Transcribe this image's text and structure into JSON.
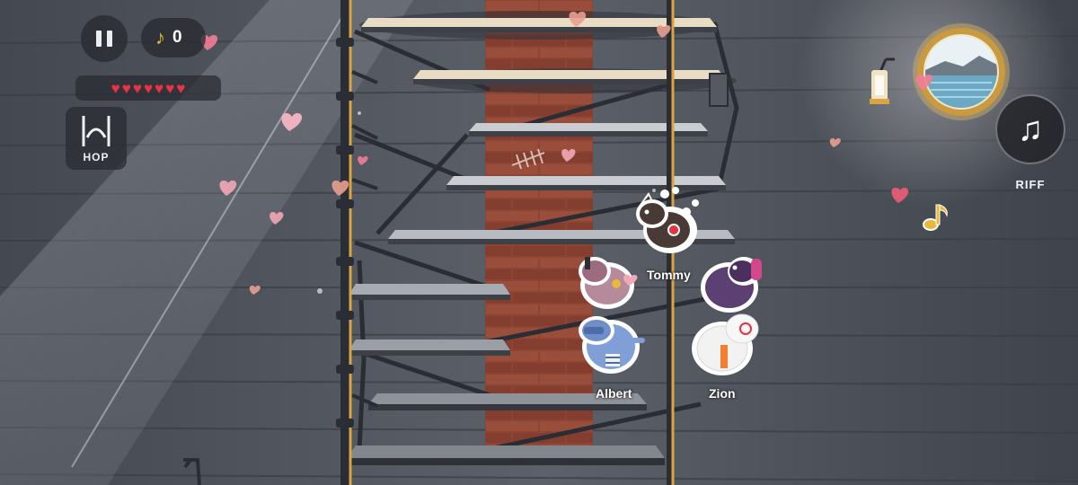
{
  "hud": {
    "notes_count": "0",
    "health_hearts": 7,
    "hop_label": "HOP",
    "riff_label": "RIFF"
  },
  "icons": {
    "pause": "pause-icon",
    "note": "music-note-icon",
    "heart": "heart-icon",
    "hop": "hop-icon",
    "riff": "double-music-note-icon"
  },
  "players": [
    {
      "name": "Tommy",
      "color": "#4a3a35"
    },
    {
      "name": "Albert",
      "color": "#7f9fd6"
    },
    {
      "name": "Zion",
      "color": "#f2f2f2"
    },
    {
      "name": "",
      "color": "#b58a9a"
    },
    {
      "name": "",
      "color": "#5c3f73"
    }
  ],
  "colors": {
    "heart": "#ee3246",
    "note": "#e9b93c",
    "brick": "#9a4a38",
    "hud_bg": "#2a2c30"
  }
}
